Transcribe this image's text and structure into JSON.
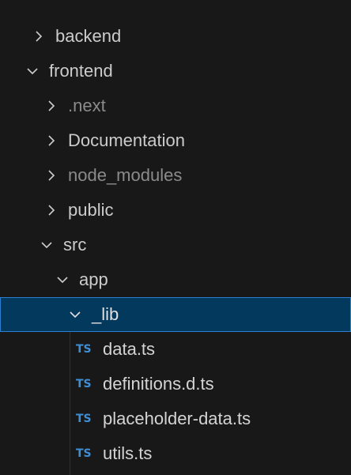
{
  "explorer": {
    "top_partial": "                   ",
    "items": [
      {
        "label": "backend",
        "type": "folder",
        "expanded": false,
        "depth": 0,
        "dim": false
      },
      {
        "label": "frontend",
        "type": "folder",
        "expanded": true,
        "depth": 0,
        "dim": false
      },
      {
        "label": ".next",
        "type": "folder",
        "expanded": false,
        "depth": 1,
        "dim": true
      },
      {
        "label": "Documentation",
        "type": "folder",
        "expanded": false,
        "depth": 1,
        "dim": false
      },
      {
        "label": "node_modules",
        "type": "folder",
        "expanded": false,
        "depth": 1,
        "dim": true
      },
      {
        "label": "public",
        "type": "folder",
        "expanded": false,
        "depth": 1,
        "dim": false
      },
      {
        "label": "src",
        "type": "folder",
        "expanded": true,
        "depth": 1,
        "dim": false
      },
      {
        "label": "app",
        "type": "folder",
        "expanded": true,
        "depth": 2,
        "dim": false
      },
      {
        "label": "_lib",
        "type": "folder",
        "expanded": true,
        "depth": 3,
        "dim": false,
        "selected": true
      },
      {
        "label": "data.ts",
        "type": "file",
        "icon": "TS",
        "depth": 4
      },
      {
        "label": "definitions.d.ts",
        "type": "file",
        "icon": "TS",
        "depth": 4
      },
      {
        "label": "placeholder-data.ts",
        "type": "file",
        "icon": "TS",
        "depth": 4
      },
      {
        "label": "utils.ts",
        "type": "file",
        "icon": "TS",
        "depth": 4
      }
    ]
  },
  "colors": {
    "background": "#181818",
    "text": "#cccccc",
    "dim_text": "#8b8b8b",
    "selected_bg": "#04395e",
    "selected_border": "#2b7fd0",
    "ts_icon": "#3e8ed6"
  }
}
